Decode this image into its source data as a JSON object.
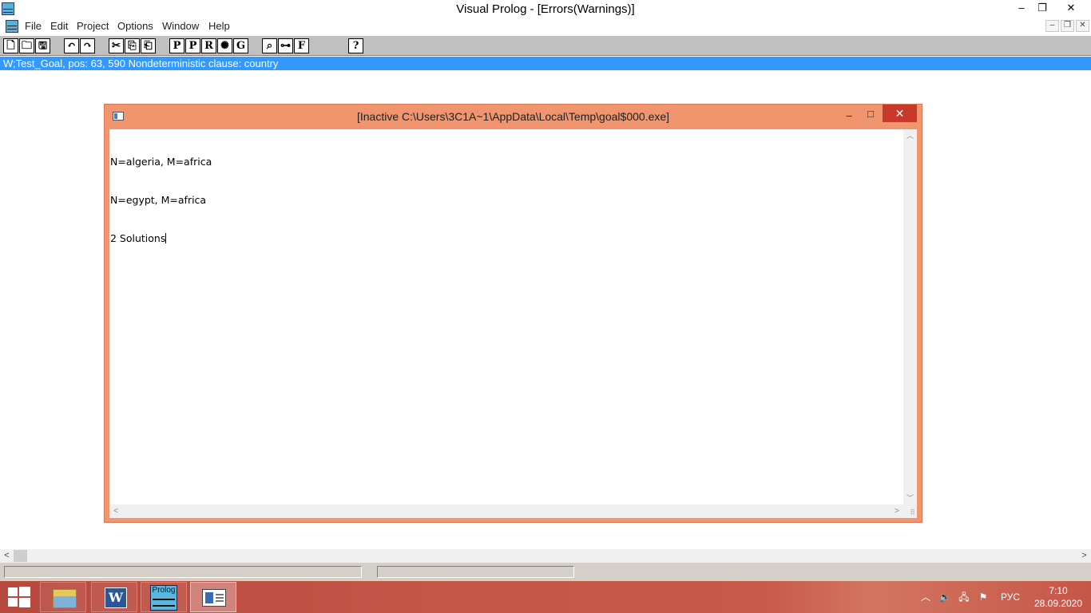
{
  "window": {
    "title": "Visual Prolog - [Errors(Warnings)]",
    "app_icon": "prolog-icon",
    "controls": {
      "minimize": "–",
      "maximize": "❐",
      "close": "✕"
    }
  },
  "menu": {
    "items": [
      "File",
      "Edit",
      "Project",
      "Options",
      "Window",
      "Help"
    ],
    "mdi_controls": {
      "minimize": "–",
      "restore": "❐",
      "close": "✕"
    }
  },
  "toolbar": {
    "buttons": [
      {
        "name": "new-file",
        "glyph": "🗋"
      },
      {
        "name": "open-file",
        "glyph": "🗀"
      },
      {
        "name": "save",
        "glyph": "🖫"
      },
      {
        "name": "undo",
        "glyph": "↶"
      },
      {
        "name": "redo",
        "glyph": "↷"
      },
      {
        "name": "cut",
        "glyph": "✂"
      },
      {
        "name": "copy",
        "glyph": "⎘"
      },
      {
        "name": "paste",
        "glyph": "⎗"
      },
      {
        "name": "compile",
        "glyph": "P"
      },
      {
        "name": "project-compile",
        "glyph": "P"
      },
      {
        "name": "run",
        "glyph": "R"
      },
      {
        "name": "debug",
        "glyph": "✺"
      },
      {
        "name": "goal",
        "glyph": "G"
      },
      {
        "name": "browse",
        "glyph": "⌕"
      },
      {
        "name": "tree",
        "glyph": "⊶"
      },
      {
        "name": "find",
        "glyph": "F"
      },
      {
        "name": "help",
        "glyph": "?"
      }
    ]
  },
  "message_line": "W;Test_Goal, pos: 63, 590 Nondeterministic clause: country",
  "inner_window": {
    "title": "[Inactive C:\\Users\\3C1A~1\\AppData\\Local\\Temp\\goal$000.exe]",
    "controls": {
      "minimize": "–",
      "maximize": "□",
      "close": "✕"
    },
    "output_lines": [
      "N=algeria, M=africa",
      "N=egypt, M=africa",
      "2 Solutions"
    ]
  },
  "taskbar": {
    "apps": [
      {
        "name": "file-explorer",
        "active": false
      },
      {
        "name": "word",
        "label": "W",
        "active": false
      },
      {
        "name": "prolog",
        "label": "Prolog",
        "active": false
      },
      {
        "name": "visual-prolog-window",
        "active": true
      }
    ],
    "language": "РУС",
    "time": "7:10",
    "date": "28.09.2020"
  },
  "colors": {
    "message_bg": "#3399ff",
    "inner_window_frame": "#f0956d",
    "close_button": "#c7392b",
    "toolbar_bg": "#c0c0c0"
  }
}
